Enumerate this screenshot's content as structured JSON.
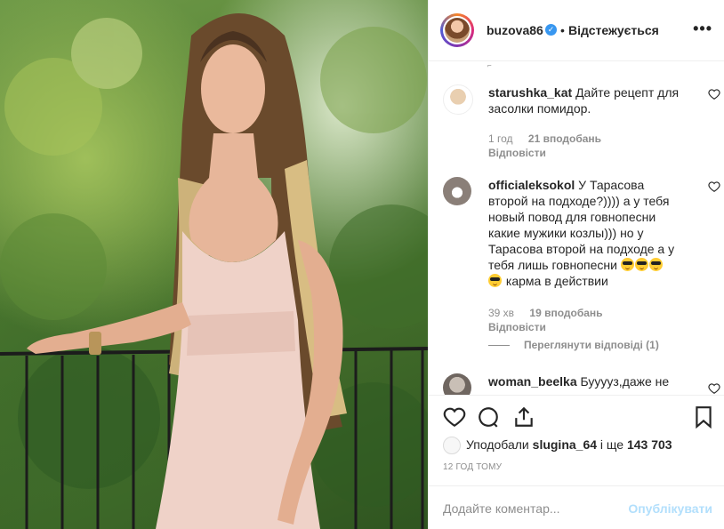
{
  "post": {
    "image_alt": ""
  },
  "header": {
    "username": "buzova86",
    "separator": "•",
    "follow_label": "Відстежується",
    "more_label": "•••"
  },
  "comments": [
    {
      "username": "starushka_kat",
      "text": "Дайте рецепт для засолки помидор.",
      "time": "1 год",
      "likes": "21 вподобань",
      "reply_label": "Відповісти"
    },
    {
      "username": "officialeksokol",
      "text": "У Тарасова второй на подходе?)))) а у тебя новый повод для говнопесни какие мужики козлы))) но у Тарасова второй на подходе а у тебя лишь говнопесни",
      "text_after_emoji": "карма в действии",
      "time": "39 хв",
      "likes": "19 вподобань",
      "reply_label": "Відповісти",
      "view_replies": "Переглянути відповіді (1)"
    },
    {
      "username": "woman_beelka",
      "text": "Бууууз,даже не"
    }
  ],
  "likes": {
    "prefix": "Уподобали",
    "user": "slugina_64",
    "connector": "і ще",
    "count": "143 703"
  },
  "time_ago": "12 ГОД ТОМУ",
  "add_comment": {
    "placeholder": "Додайте коментар...",
    "post_label": "Опублікувати"
  },
  "colors": {
    "accent": "#3897f0",
    "post_disabled": "#b2dffc",
    "muted": "#8e8e8e"
  }
}
